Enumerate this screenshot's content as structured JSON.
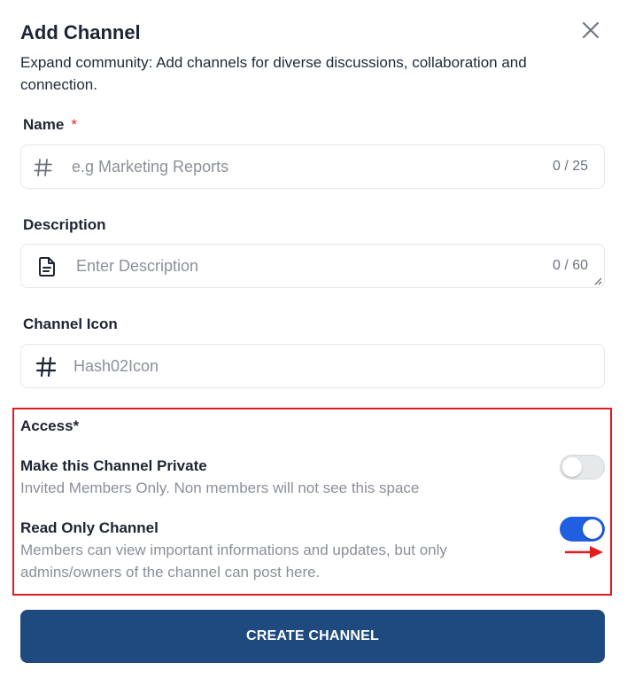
{
  "dialog": {
    "title": "Add Channel",
    "subtitle": "Expand community: Add channels for diverse discussions, collaboration and connection."
  },
  "name_field": {
    "label": "Name",
    "required_mark": "*",
    "placeholder": "e.g Marketing Reports",
    "counter": "0 / 25",
    "icon": "hash-icon"
  },
  "description_field": {
    "label": "Description",
    "placeholder": "Enter Description",
    "counter": "0 / 60",
    "icon": "document-icon"
  },
  "channel_icon_field": {
    "label": "Channel Icon",
    "value": "Hash02Icon",
    "icon": "hash-icon"
  },
  "access": {
    "title": "Access*",
    "private": {
      "title": "Make this Channel Private",
      "description": "Invited Members Only. Non members will not see this space",
      "enabled": false
    },
    "read_only": {
      "title": "Read Only Channel",
      "description": "Members can view important informations and updates, but only admins/owners of the channel can post here.",
      "enabled": true
    }
  },
  "actions": {
    "create_label": "CREATE CHANNEL"
  },
  "colors": {
    "primary_button": "#1e4a7f",
    "toggle_on": "#1f5fe0",
    "highlight": "#e11d22"
  }
}
